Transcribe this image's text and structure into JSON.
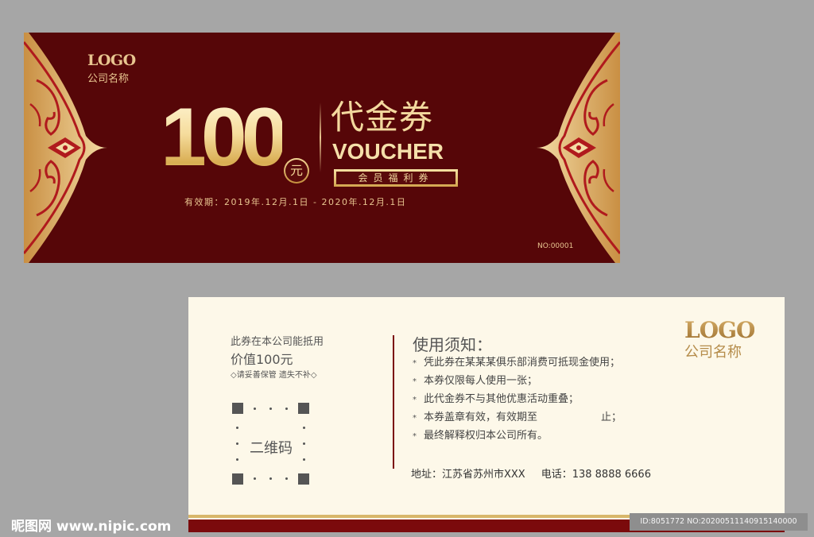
{
  "colors": {
    "page_background": "#a6a6a6",
    "front_background": "#560608",
    "gold": "#e8c590",
    "back_background": "#fdf8e9",
    "dark_red": "#7b0a0c"
  },
  "front": {
    "logo": "LOGO",
    "company": "公司名称",
    "amount": "100",
    "currency": "元",
    "title_cn": "代金券",
    "title_en": "VOUCHER",
    "tag": "会员福利券",
    "validity": "有效期：2019年.12月.1日 - 2020年.12月.1日",
    "serial": "NO:00001",
    "ornament_icon": "gold-filigree-corner-icon"
  },
  "back": {
    "line1": "此券在本公司能抵用",
    "line2": "价值100元",
    "line3": "◇请妥善保管 遗失不补◇",
    "qr_label": "二维码",
    "notice_title": "使用须知：",
    "notices": [
      {
        "text": "凭此券在某某某俱乐部消费可抵现金使用；"
      },
      {
        "text": "本券仅限每人使用一张；"
      },
      {
        "text": "此代金券不与其他优惠活动重叠；"
      },
      {
        "text": "本券盖章有效，有效期至",
        "suffix": "止；"
      },
      {
        "text": "最终解释权归本公司所有。"
      }
    ],
    "bullet": "*",
    "address": "地址：江苏省苏州市XXX",
    "phone": "电话：138 8888 6666",
    "logo": "LOGO",
    "company": "公司名称"
  },
  "watermark": {
    "site": "昵图网 www.nipic.com",
    "id_text": "ID:8051772 NO:20200511140915140000"
  }
}
